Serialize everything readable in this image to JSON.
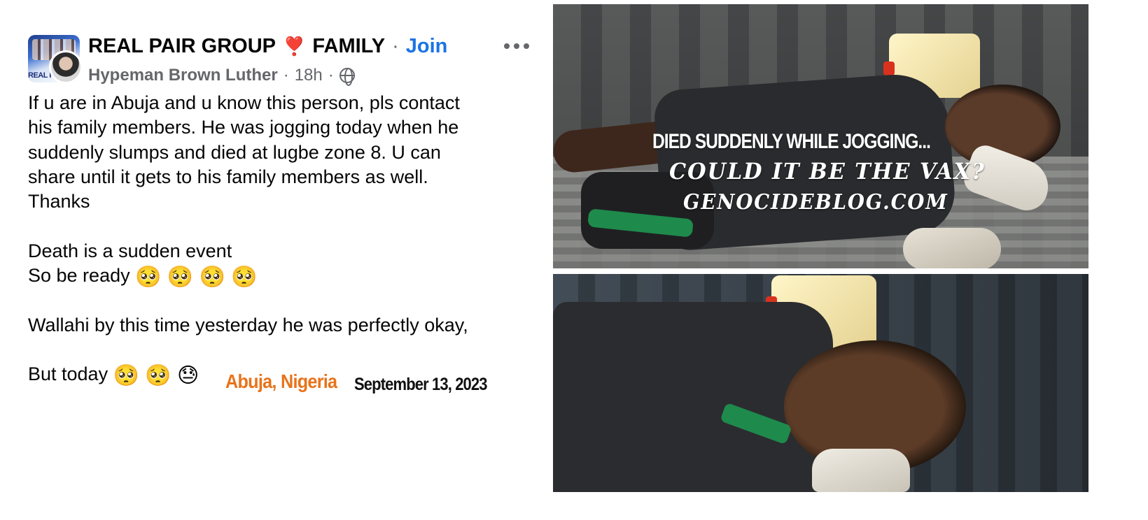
{
  "post": {
    "group_name": "REAL PAIR GROUP",
    "heart_emoji": "❣️",
    "group_name_suffix": "FAMILY",
    "separator": "·",
    "join_label": "Join",
    "group_thumb_text": "REAL PAIR",
    "author": "Hypeman Brown Luther",
    "meta_sep1": "·",
    "time": "18h",
    "meta_sep2": "·",
    "privacy_icon": "globe-icon",
    "body_lines": [
      "If u are in Abuja and u know this person, pls contact",
      "his family members. He was jogging today when he",
      "suddenly slumps and died at lugbe zone 8. U can",
      "share until it gets to his family members as well.",
      "Thanks"
    ],
    "line_death": "Death is a sudden event",
    "line_ready": "So be ready",
    "ready_emojis": "🥺 🥺 🥺 🥺",
    "line_wallahi": "Wallahi by this time yesterday he was perfectly okay,",
    "line_today": "But today",
    "today_emojis": "🥺 🥺 😓"
  },
  "annotations": {
    "location": "Abuja, Nigeria",
    "date": "September 13, 2023"
  },
  "photo_overlay": {
    "line1": "DIED SUDDENLY WHILE JOGGING...",
    "line2": "COULD IT BE THE VAX?",
    "line3": "GENOCIDEBLOG.COM"
  },
  "colors": {
    "join_blue": "#1b74e4",
    "meta_gray": "#65676b",
    "location_orange": "#e8731a",
    "shirt_stripe_green": "#1e8a4c"
  }
}
